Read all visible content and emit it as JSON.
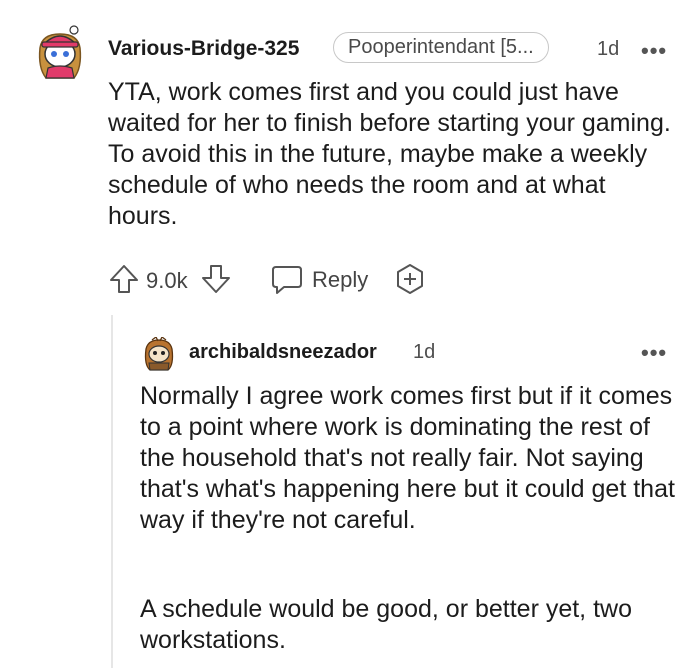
{
  "comment": {
    "username": "Various-Bridge-325",
    "flair": "Pooperintendant [5...",
    "time": "1d",
    "more": "•••",
    "body": "YTA, work comes first and you could just have waited for her to finish before starting your gaming. To avoid this in the future, maybe make a weekly schedule of who needs the room and at what hours.",
    "actions": {
      "vote_count": "9.0k",
      "reply_label": "Reply"
    }
  },
  "reply": {
    "username": "archibaldsneezador",
    "time": "1d",
    "more": "•••",
    "paragraphs": [
      "Normally I agree work comes first but if it comes to a point where work is dominating the rest of the household that's not really fair. Not saying that's what's happening here but it could get that way if they're not careful.",
      "A schedule would be good, or better yet, two workstations."
    ]
  },
  "icons": {
    "upvote": "upvote-arrow-icon",
    "downvote": "downvote-arrow-icon",
    "reply": "speech-bubble-icon",
    "award": "award-plus-icon"
  },
  "colors": {
    "text": "#1c1c1c",
    "meta": "#4f4f4f",
    "border": "#c8c8c8"
  }
}
